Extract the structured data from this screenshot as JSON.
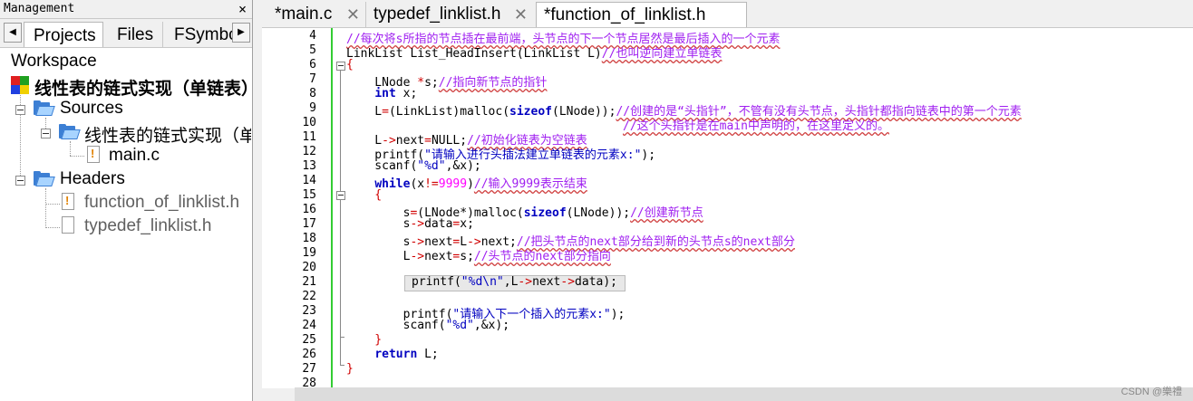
{
  "management": {
    "title": "Management",
    "close_glyph": "×",
    "tabs": [
      "Projects",
      "Files",
      "FSymbo"
    ],
    "arrow_left": "◀",
    "arrow_right": "▶",
    "tree": {
      "workspace": "Workspace",
      "project": "线性表的链式实现（单链表）",
      "sources": "Sources",
      "sources_sub": "线性表的链式实现（单链",
      "main_file": "main.c",
      "headers": "Headers",
      "header_files": [
        "function_of_linklist.h",
        "typedef_linklist.h"
      ]
    }
  },
  "editor": {
    "tabs": [
      {
        "label": "*main.c",
        "close": "✕"
      },
      {
        "label": "typedef_linklist.h",
        "close": "✕"
      },
      {
        "label": "*function_of_linklist.h",
        "close": ""
      }
    ],
    "line_numbers": [
      "4",
      "5",
      "6",
      "7",
      "8",
      "9",
      "10",
      "11",
      "12",
      "13",
      "14",
      "15",
      "16",
      "17",
      "18",
      "19",
      "20",
      "21",
      "22",
      "23",
      "24",
      "25",
      "26",
      "27",
      "28"
    ],
    "code": {
      "l4": "//每次将s所指的节点插在最前端，头节点的下一个节点居然是最后插入的一个元素",
      "l5a": "LinkList List_HeadInsert(LinkList L)",
      "l5b": "//也叫逆向建立单链表",
      "l6": "{",
      "l7a": "    LNode ",
      "l7b": "*",
      "l7c": "s;",
      "l7d": "//指向新节点的指针",
      "l8a": "    ",
      "l8b": "int",
      "l8c": " x;",
      "l9a": "    L",
      "l9b": "=",
      "l9c": "(LinkList)malloc(",
      "l9d": "sizeof",
      "l9e": "(LNode));",
      "l9f": "//创建的是“头指针”，不管有没有头节点，头指针都指向链表中的第一个元素",
      "l10": "//这个头指针是在main中声明的，在这里定义的。",
      "l11a": "    L",
      "l11b": "->",
      "l11c": "next",
      "l11d": "=",
      "l11e": "NULL;",
      "l11f": "//初始化链表为空链表",
      "l12a": "    printf(",
      "l12b": "\"请输入进行头插法建立单链表的元素x:\"",
      "l12c": ");",
      "l13a": "    scanf(",
      "l13b": "\"%d\"",
      "l13c": ",&x);",
      "l14a": "    ",
      "l14b": "while",
      "l14c": "(x",
      "l14d": "!=",
      "l14e": "9999",
      "l14f": ")",
      "l14g": "//输入9999表示结束",
      "l15": "    {",
      "l16a": "        s",
      "l16b": "=",
      "l16c": "(LNode*)malloc(",
      "l16d": "sizeof",
      "l16e": "(LNode));",
      "l16f": "//创建新节点",
      "l17a": "        s",
      "l17b": "->",
      "l17c": "data",
      "l17d": "=",
      "l17e": "x;",
      "l18a": "        s",
      "l18b": "->",
      "l18c": "next",
      "l18d": "=",
      "l18e": "L",
      "l18f": "->",
      "l18g": "next;",
      "l18h": "//把头节点的next部分给到新的头节点s的next部分",
      "l19a": "        L",
      "l19b": "->",
      "l19c": "next",
      "l19d": "=",
      "l19e": "s;",
      "l19f": "//头节点的next部分指向",
      "l20": "",
      "l21a": "printf(",
      "l21b": "\"%d\\n\"",
      "l21c": ",L",
      "l21d": "->",
      "l21e": "next",
      "l21f": "->",
      "l21g": "data);",
      "l22": "",
      "l23a": "        printf(",
      "l23b": "\"请输入下一个插入的元素x:\"",
      "l23c": ");",
      "l24a": "        scanf(",
      "l24b": "\"%d\"",
      "l24c": ",&x);",
      "l25": "    }",
      "l26a": "    ",
      "l26b": "return",
      "l26c": " L;",
      "l27": "}",
      "l28": ""
    }
  },
  "watermark": "CSDN @樂禮",
  "colors": {
    "keyword": "#0000c0",
    "comment": "#a020f0",
    "number": "#ff00ff",
    "operator": "#d00000",
    "change_bar": "#33cc33",
    "folder": "#3c7fd4"
  }
}
